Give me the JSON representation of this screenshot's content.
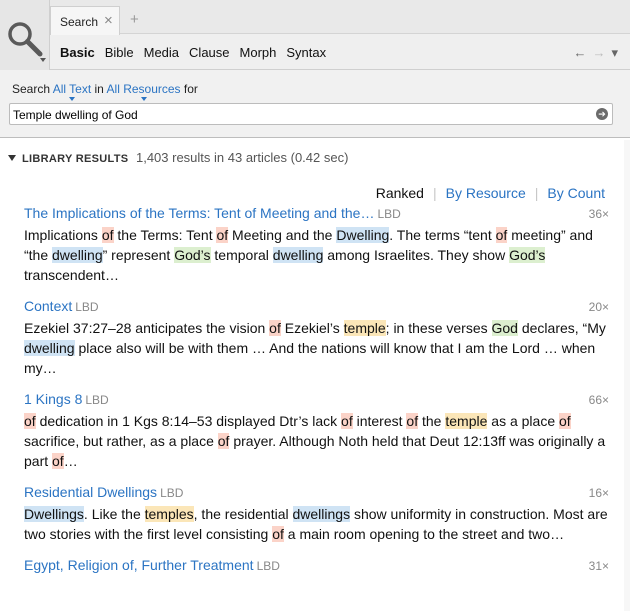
{
  "tabs": {
    "search_label": "Search",
    "close_glyph": "×",
    "add_glyph": "+"
  },
  "subtabs": [
    "Basic",
    "Bible",
    "Media",
    "Clause",
    "Morph",
    "Syntax"
  ],
  "nav": {
    "back": "←",
    "forward": "→",
    "menu": "▾"
  },
  "search": {
    "prefix": "Search",
    "scope": "All Text",
    "in_word": "in",
    "resources": "All Resources",
    "for_word": "for",
    "query": "Temple dwelling of God",
    "go_glyph": "➔"
  },
  "library": {
    "title": "LIBRARY RESULTS",
    "summary": "1,403 results in 43 articles (0.42 sec)"
  },
  "sort": {
    "ranked": "Ranked",
    "by_resource": "By Resource",
    "by_count": "By Count"
  },
  "results": [
    {
      "title": "The Implications of the Terms: Tent of Meeting and the…",
      "source": "LBD",
      "count": "36×",
      "snippet": [
        {
          "t": "Implications "
        },
        {
          "t": "of",
          "h": "of"
        },
        {
          "t": " the Terms: Tent "
        },
        {
          "t": "of",
          "h": "of"
        },
        {
          "t": " Meeting and the "
        },
        {
          "t": "Dwelling",
          "h": "dw"
        },
        {
          "t": ". The terms “tent "
        },
        {
          "t": "of",
          "h": "of"
        },
        {
          "t": " meeting” and “the "
        },
        {
          "t": "dwelling",
          "h": "dw"
        },
        {
          "t": "” represent "
        },
        {
          "t": "God’s",
          "h": "god"
        },
        {
          "t": " temporal "
        },
        {
          "t": "dwelling",
          "h": "dw"
        },
        {
          "t": " among Israelites. They show "
        },
        {
          "t": "God’s",
          "h": "god"
        },
        {
          "t": " transcendent…"
        }
      ]
    },
    {
      "title": "Context",
      "source": "LBD",
      "count": "20×",
      "snippet": [
        {
          "t": "Ezekiel 37:27–28 anticipates the vision "
        },
        {
          "t": "of",
          "h": "of"
        },
        {
          "t": " Ezekiel’s "
        },
        {
          "t": "temple",
          "h": "tmp"
        },
        {
          "t": "; in these verses "
        },
        {
          "t": "God",
          "h": "god"
        },
        {
          "t": " declares, “My "
        },
        {
          "t": "dwelling",
          "h": "dw"
        },
        {
          "t": " place also will be with them … And the nations will know that I am the Lord … when my…"
        }
      ]
    },
    {
      "title": "1 Kings 8",
      "source": "LBD",
      "count": "66×",
      "snippet": [
        {
          "t": "of",
          "h": "of"
        },
        {
          "t": " dedication in 1 Kgs 8:14–53 displayed Dtr’s lack "
        },
        {
          "t": "of",
          "h": "of"
        },
        {
          "t": " interest "
        },
        {
          "t": "of",
          "h": "of"
        },
        {
          "t": " the "
        },
        {
          "t": "temple",
          "h": "tmp"
        },
        {
          "t": " as a place "
        },
        {
          "t": "of",
          "h": "of"
        },
        {
          "t": " sacrifice, but rather, as a place "
        },
        {
          "t": "of",
          "h": "of"
        },
        {
          "t": " prayer. Although Noth held that Deut 12:13ff was originally a part "
        },
        {
          "t": "of",
          "h": "of"
        },
        {
          "t": "…"
        }
      ]
    },
    {
      "title": "Residential Dwellings",
      "source": "LBD",
      "count": "16×",
      "snippet": [
        {
          "t": "Dwellings",
          "h": "dw"
        },
        {
          "t": ". Like the "
        },
        {
          "t": "temples",
          "h": "tmp"
        },
        {
          "t": ", the residential "
        },
        {
          "t": "dwellings",
          "h": "dw"
        },
        {
          "t": " show uniformity in construction. Most are two stories with the first level consisting "
        },
        {
          "t": "of",
          "h": "of"
        },
        {
          "t": " a main room opening to the street and two…"
        }
      ]
    },
    {
      "title": "Egypt, Religion of, Further Treatment",
      "source": "LBD",
      "count": "31×",
      "snippet": []
    }
  ]
}
